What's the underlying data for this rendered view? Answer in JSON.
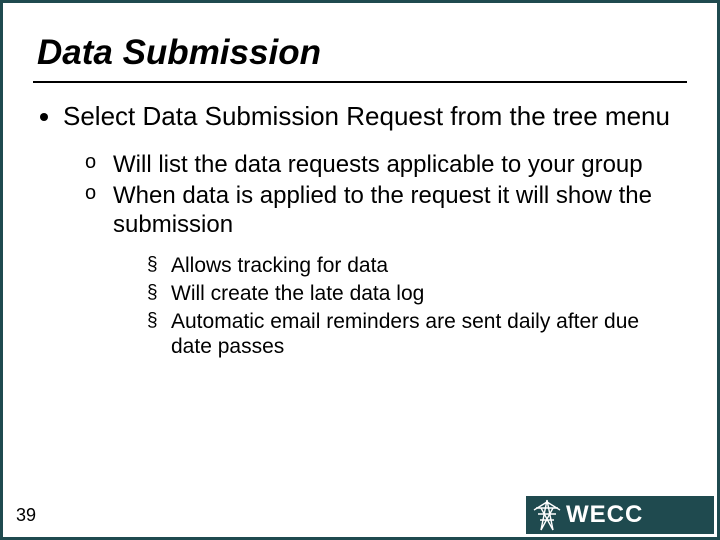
{
  "title": "Data Submission",
  "bullets": {
    "l1_0": "Select Data Submission Request from the tree menu",
    "l2_0": "Will list the data requests applicable to your group",
    "l2_1": "When data is applied to the request it will show the submission",
    "l3_0": "Allows tracking for data",
    "l3_1": "Will create the late data log",
    "l3_2": "Automatic email reminders are sent daily after due date passes"
  },
  "page_number": "39",
  "logo_text": "WECC"
}
